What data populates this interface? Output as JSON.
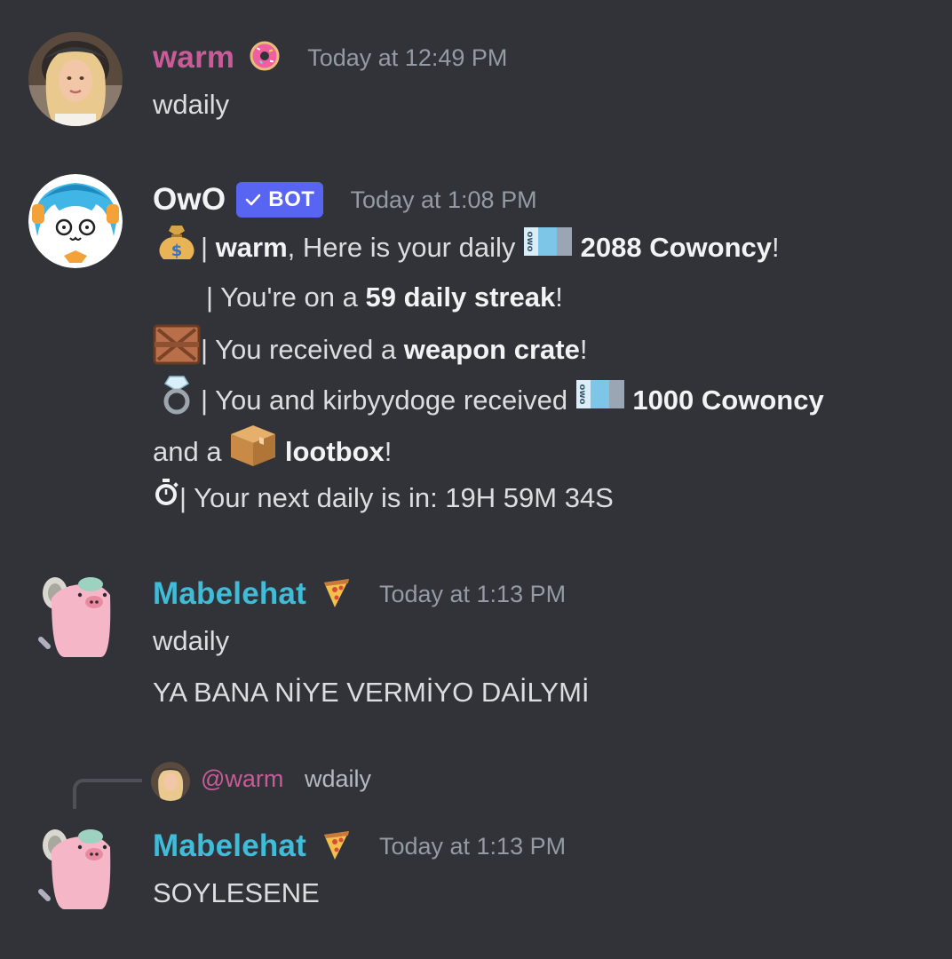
{
  "theme": {
    "background": "#313338",
    "text": "#dbdee1",
    "muted": "#949ba4",
    "bot_badge": "#5865f2",
    "warm_color": "#c95b98",
    "mabelehat_color": "#40bcd8"
  },
  "messages": [
    {
      "author": "warm",
      "decoration_icon": "donut-icon",
      "timestamp": "Today at 12:49 PM",
      "lines": [
        "wdaily"
      ]
    },
    {
      "author": "OwO",
      "badge": "BOT",
      "timestamp": "Today at 1:08 PM",
      "lines": {
        "l1": {
          "icon": "money-bag-icon",
          "sep": "|",
          "user": "warm",
          "text_a": ", Here is your daily ",
          "currency_icon": "cowoncy-icon",
          "amount": "2088 Cowoncy",
          "end": "!"
        },
        "l2": {
          "sep": "|",
          "text_a": "You're on a ",
          "bold": "59 daily streak",
          "end": "!"
        },
        "l3": {
          "icon": "crate-icon",
          "sep": "|",
          "text_a": "You received a ",
          "bold": "weapon crate",
          "end": "!"
        },
        "l4": {
          "icon": "ring-icon",
          "sep": "|",
          "text_a": "You and kirbyydoge received ",
          "currency_icon": "cowoncy-icon",
          "amount": "1000 Cowoncy"
        },
        "l5": {
          "text_a": "and a ",
          "box_icon": "package-icon",
          "bold": "lootbox",
          "end": "!"
        },
        "l6": {
          "icon": "stopwatch-icon",
          "sep": "|",
          "text_a": "Your next daily is in: 19H 59M 34S"
        }
      }
    },
    {
      "author": "Mabelehat",
      "decoration_icon": "pizza-icon",
      "timestamp": "Today at 1:13 PM",
      "lines": [
        "wdaily",
        "YA BANA NİYE VERMİYO DAİLYMİ"
      ]
    },
    {
      "reply": {
        "user": "@warm",
        "text": "wdaily"
      },
      "author": "Mabelehat",
      "decoration_icon": "pizza-icon",
      "timestamp": "Today at 1:13 PM",
      "lines": [
        "SOYLESENE"
      ]
    }
  ]
}
